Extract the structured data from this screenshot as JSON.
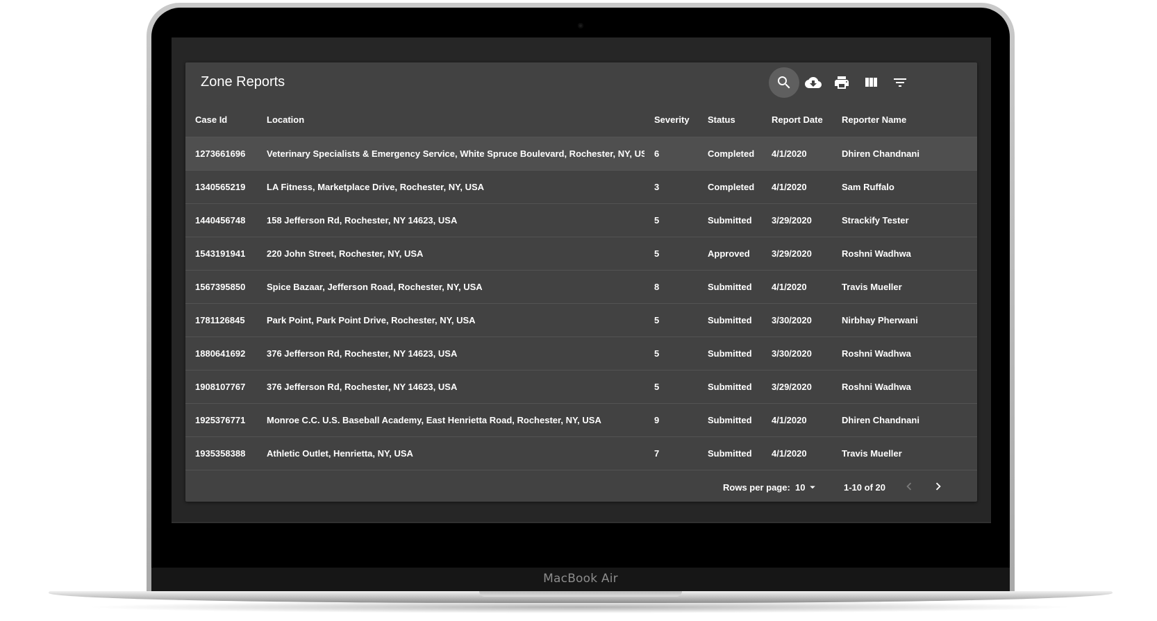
{
  "device": {
    "brand_label": "MacBook Air"
  },
  "card": {
    "title": "Zone Reports"
  },
  "toolbar": {
    "icons": [
      "search-icon",
      "cloud-download-icon",
      "print-icon",
      "view-column-icon",
      "filter-list-icon"
    ]
  },
  "table": {
    "columns": [
      "Case Id",
      "Location",
      "Severity",
      "Status",
      "Report Date",
      "Reporter Name"
    ],
    "rows": [
      [
        "1273661696",
        "Veterinary Specialists & Emergency Service, White Spruce Boulevard, Rochester, NY, USA",
        "6",
        "Completed",
        "4/1/2020",
        "Dhiren Chandnani"
      ],
      [
        "1340565219",
        "LA Fitness, Marketplace Drive, Rochester, NY, USA",
        "3",
        "Completed",
        "4/1/2020",
        "Sam Ruffalo"
      ],
      [
        "1440456748",
        "158 Jefferson Rd, Rochester, NY 14623, USA",
        "5",
        "Submitted",
        "3/29/2020",
        "Strackify Tester"
      ],
      [
        "1543191941",
        "220 John Street, Rochester, NY, USA",
        "5",
        "Approved",
        "3/29/2020",
        "Roshni Wadhwa"
      ],
      [
        "1567395850",
        "Spice Bazaar, Jefferson Road, Rochester, NY, USA",
        "8",
        "Submitted",
        "4/1/2020",
        "Travis Mueller"
      ],
      [
        "1781126845",
        "Park Point, Park Point Drive, Rochester, NY, USA",
        "5",
        "Submitted",
        "3/30/2020",
        "Nirbhay Pherwani"
      ],
      [
        "1880641692",
        "376 Jefferson Rd, Rochester, NY 14623, USA",
        "5",
        "Submitted",
        "3/30/2020",
        "Roshni Wadhwa"
      ],
      [
        "1908107767",
        "376 Jefferson Rd, Rochester, NY 14623, USA",
        "5",
        "Submitted",
        "3/29/2020",
        "Roshni Wadhwa"
      ],
      [
        "1925376771",
        "Monroe C.C. U.S. Baseball Academy, East Henrietta Road, Rochester, NY, USA",
        "9",
        "Submitted",
        "4/1/2020",
        "Dhiren Chandnani"
      ],
      [
        "1935358388",
        "Athletic Outlet, Henrietta, NY, USA",
        "7",
        "Submitted",
        "4/1/2020",
        "Travis Mueller"
      ]
    ]
  },
  "pagination": {
    "rows_per_page_label": "Rows per page:",
    "rows_per_page_value": "10",
    "range_label": "1-10 of 20"
  },
  "colors": {
    "screen_bg": "#262626",
    "card_bg": "#424242",
    "hover_row_bg": "#4f4f4f",
    "text": "#ffffff"
  }
}
